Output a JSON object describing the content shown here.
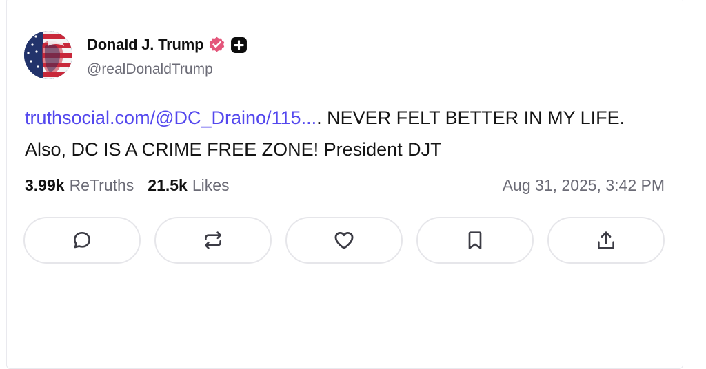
{
  "post": {
    "author": {
      "display_name": "Donald J. Trump",
      "handle": "@realDonaldTrump",
      "verified_icon": "verified-badge-icon",
      "plus_icon": "plus-badge-icon"
    },
    "body": {
      "link_text": "truthsocial.com/@DC_Draino/115...",
      "text": ". NEVER FELT BETTER IN MY LIFE. Also, DC IS A CRIME FREE ZONE! President DJT"
    },
    "stats": {
      "retruths_count": "3.99k",
      "retruths_label": "ReTruths",
      "likes_count": "21.5k",
      "likes_label": "Likes"
    },
    "timestamp": "Aug 31, 2025, 3:42 PM",
    "actions": [
      {
        "name": "reply",
        "icon": "comment-icon"
      },
      {
        "name": "retruth",
        "icon": "repost-icon"
      },
      {
        "name": "like",
        "icon": "heart-icon"
      },
      {
        "name": "bookmark",
        "icon": "bookmark-icon"
      },
      {
        "name": "share",
        "icon": "share-icon"
      }
    ]
  },
  "colors": {
    "link": "#5448ee",
    "verified": "#e4567b",
    "muted_text": "#6b6b76",
    "button_border": "#e6e6ea"
  }
}
